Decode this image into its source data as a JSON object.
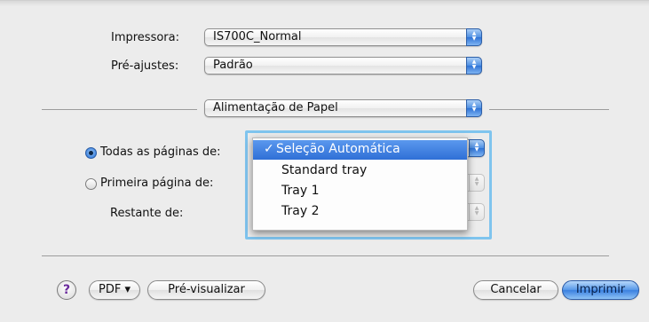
{
  "printer": {
    "label": "Impressora:",
    "value": "IS700C_Normal"
  },
  "presets": {
    "label": "Pré-ajustes:",
    "value": "Padrão"
  },
  "panel": {
    "value": "Alimentação de Papel"
  },
  "options": {
    "all_pages_label": "Todas as páginas de:",
    "first_page_label": "Primeira página de:",
    "remaining_label": "Restante de:"
  },
  "tray_menu": {
    "items": [
      "Seleção Automática",
      "Standard tray",
      "Tray 1",
      "Tray 2"
    ],
    "selected_check": "✓"
  },
  "buttons": {
    "help": "?",
    "pdf": "PDF ▾",
    "preview": "Pré-visualizar",
    "cancel": "Cancelar",
    "print": "Imprimir"
  },
  "icons": {
    "popup_arrows": "up-down-arrows-icon",
    "check": "checkmark-icon",
    "help": "question-mark-icon"
  }
}
